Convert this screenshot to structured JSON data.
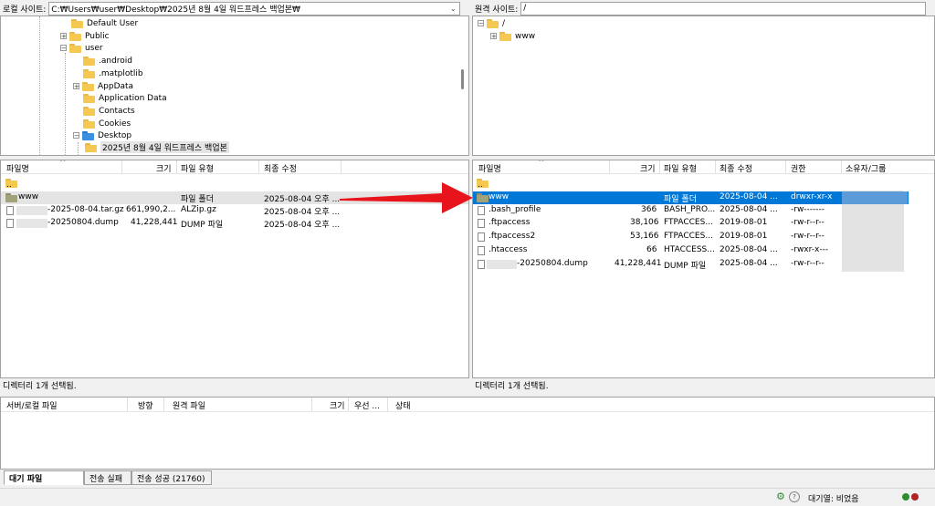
{
  "local_site": {
    "label": "로컬 사이트:",
    "path": "C:₩Users₩user₩Desktop₩2025년 8월 4일 워드프레스 백업본₩",
    "tree": [
      {
        "label": "Default User",
        "icon": "folder-icon"
      },
      {
        "label": "Public",
        "icon": "folder-icon"
      },
      {
        "label": "user",
        "icon": "folder-icon"
      },
      {
        "label": ".android",
        "icon": "folder-icon"
      },
      {
        "label": ".matplotlib",
        "icon": "folder-icon"
      },
      {
        "label": "AppData",
        "icon": "folder-icon"
      },
      {
        "label": "Application Data",
        "icon": "folder-icon"
      },
      {
        "label": "Contacts",
        "icon": "folder-icon"
      },
      {
        "label": "Cookies",
        "icon": "folder-icon"
      },
      {
        "label": "Desktop",
        "icon": "desktop-folder-icon"
      },
      {
        "label": "2025년 8월 4일 워드프레스 백업본",
        "icon": "folder-icon"
      }
    ],
    "columns": {
      "name": "파일명",
      "size": "크기",
      "type": "파일 유형",
      "modified": "최종 수정"
    },
    "files": [
      {
        "name": "..",
        "size": "",
        "type": "",
        "modified": ""
      },
      {
        "name": "www",
        "size": "",
        "type": "파일 폴더",
        "modified": "2025-08-04 오후 ..."
      },
      {
        "name": "-2025-08-04.tar.gz",
        "size": "661,990,2...",
        "type": "ALZip.gz",
        "modified": "2025-08-04 오후 ..."
      },
      {
        "name": "-20250804.dump",
        "size": "41,228,441",
        "type": "DUMP 파일",
        "modified": "2025-08-04 오후 ..."
      }
    ],
    "status": "디렉터리 1개 선택됨."
  },
  "remote_site": {
    "label": "원격 사이트:",
    "path": "/",
    "tree": [
      {
        "label": "/",
        "icon": "folder-icon"
      },
      {
        "label": "www",
        "icon": "folder-icon"
      }
    ],
    "columns": {
      "name": "파일명",
      "size": "크기",
      "type": "파일 유형",
      "modified": "최종 수정",
      "perms": "권한",
      "owner": "소유자/그룹"
    },
    "files": [
      {
        "name": "..",
        "size": "",
        "type": "",
        "modified": "",
        "perms": ""
      },
      {
        "name": "www",
        "size": "",
        "type": "파일 폴더",
        "modified": "2025-08-04 ...",
        "perms": "drwxr-xr-x"
      },
      {
        "name": ".bash_profile",
        "size": "366",
        "type": "BASH_PRO...",
        "modified": "2025-08-04 ...",
        "perms": "-rw-------"
      },
      {
        "name": ".ftpaccess",
        "size": "38,106",
        "type": "FTPACCES...",
        "modified": "2019-08-01",
        "perms": "-rw-r--r--"
      },
      {
        "name": ".ftpaccess2",
        "size": "53,166",
        "type": "FTPACCES...",
        "modified": "2019-08-01",
        "perms": "-rw-r--r--"
      },
      {
        "name": ".htaccess",
        "size": "66",
        "type": "HTACCESS...",
        "modified": "2025-08-04 ...",
        "perms": "-rwxr-x---"
      },
      {
        "name": "-20250804.dump",
        "size": "41,228,441",
        "type": "DUMP 파일",
        "modified": "2025-08-04 ...",
        "perms": "-rw-r--r--"
      }
    ],
    "status": "디렉터리 1개 선택됨."
  },
  "queue": {
    "columns": {
      "file": "서버/로컬 파일",
      "direction": "방향",
      "remote": "원격 파일",
      "size": "크기",
      "priority": "우선 ...",
      "status": "상태"
    }
  },
  "tabs": [
    {
      "label": "대기 파일"
    },
    {
      "label": "전송 실패"
    },
    {
      "label": "전송 성공 (21760)"
    }
  ],
  "statusbar": {
    "queue": "대기열: 비었음"
  },
  "colors": {
    "selection": "#0078d7",
    "arrow": "#e8141b"
  }
}
